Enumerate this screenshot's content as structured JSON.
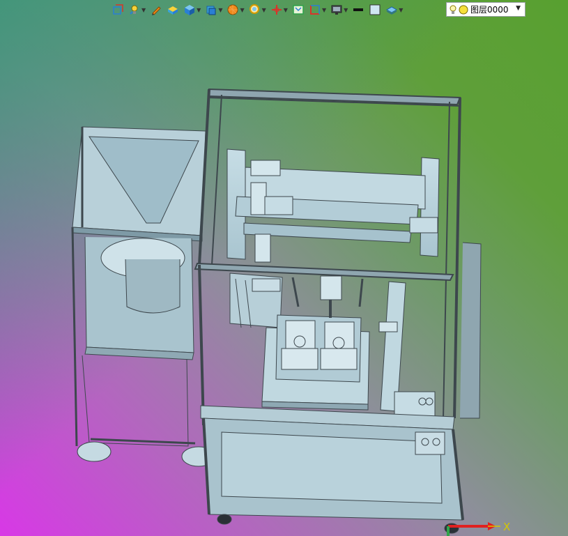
{
  "toolbar": {
    "items": [
      {
        "icon": "view-orientation-icon",
        "has_menu": false
      },
      {
        "icon": "light-bulb-icon",
        "has_menu": true
      },
      {
        "icon": "pencil-icon",
        "has_menu": false
      },
      {
        "icon": "shaded-cube-icon",
        "has_menu": false
      },
      {
        "icon": "solid-cube-icon",
        "has_menu": true
      },
      {
        "icon": "view-cube-icon",
        "has_menu": true
      },
      {
        "icon": "render-ball-icon",
        "has_menu": true
      },
      {
        "icon": "zoom-lens-icon",
        "has_menu": true
      },
      {
        "icon": "axis-triad-icon",
        "has_menu": true
      },
      {
        "icon": "fit-view-icon",
        "has_menu": false
      },
      {
        "icon": "section-view-icon",
        "has_menu": true
      },
      {
        "icon": "display-monitor-icon",
        "has_menu": true
      },
      {
        "icon": "line-weight-icon",
        "has_menu": false
      },
      {
        "icon": "color-swatch-icon",
        "has_menu": false
      },
      {
        "icon": "layer-stack-icon",
        "has_menu": true
      }
    ],
    "colors": {
      "blue": "#2a7fd4",
      "red": "#d9342b",
      "orange": "#f08a1c",
      "green": "#2fa34a"
    }
  },
  "layer_selector": {
    "value": "图层0000",
    "icons": [
      "bulb-icon",
      "layer-color-dot-icon"
    ]
  },
  "viewport": {
    "gradient_colors": [
      "#d838e6",
      "#8d8f9a",
      "#58a030"
    ],
    "model_color": "#b9d3dc",
    "frame_color": "#6f7b83"
  },
  "triad": {
    "x_label": "X",
    "x_color": "#e02020",
    "y_color": "#2fa34a"
  }
}
